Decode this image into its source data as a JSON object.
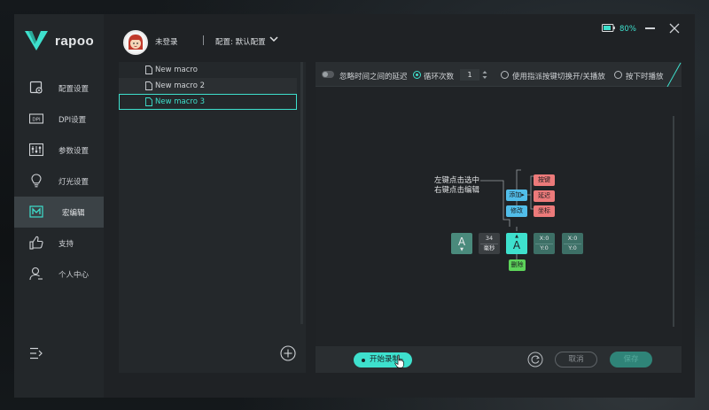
{
  "brand": {
    "logo_text": "rapoo",
    "accent": "#3ee0cd"
  },
  "sidebar": {
    "items": [
      {
        "label": "配置设置",
        "icon": "profile-settings-icon"
      },
      {
        "label": "DPI设置",
        "icon": "dpi-icon"
      },
      {
        "label": "参数设置",
        "icon": "sliders-icon"
      },
      {
        "label": "灯光设置",
        "icon": "lightbulb-icon"
      },
      {
        "label": "宏编辑",
        "icon": "macro-icon",
        "active": true
      },
      {
        "label": "支持",
        "icon": "thumbs-up-icon"
      },
      {
        "label": "个人中心",
        "icon": "user-icon"
      }
    ],
    "collapse_icon": "collapse-menu-icon"
  },
  "header": {
    "user_name": "未登录",
    "config_label": "配置: 默认配置",
    "battery_pct": "80%"
  },
  "macro_list": {
    "items": [
      {
        "name": "New macro"
      },
      {
        "name": "New macro 2"
      },
      {
        "name": "New macro 3",
        "selected": true
      }
    ]
  },
  "options": {
    "ignore_delay": "忽略时间之间的延迟",
    "loop_count_label": "循环次数",
    "loop_count_value": "1",
    "toggle_playback": "使用指派按键切换开/关播放",
    "hold_playback": "按下时播放"
  },
  "guide": {
    "line1": "左键点击选中",
    "line2": "右键点击编辑",
    "add_label": "添加▸",
    "modify_label": "修改",
    "delete_label": "删除",
    "menu_key": "按键",
    "menu_delay": "延迟",
    "menu_coord": "坐标",
    "key_a_left": "A",
    "key_a_sel": "A",
    "delay_value": "34",
    "delay_unit": "毫秒",
    "coord1_x": "X:0",
    "coord1_y": "Y:0",
    "coord2_x": "X:0",
    "coord2_y": "Y:0"
  },
  "bottom": {
    "record_label": "开始录制",
    "cancel_label": "取消",
    "save_label": "保存"
  }
}
